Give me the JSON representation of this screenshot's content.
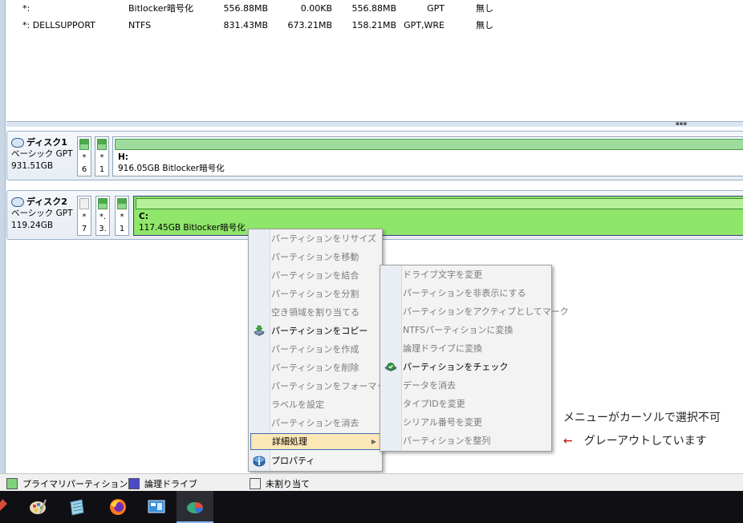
{
  "table": {
    "rows": [
      {
        "name": "*:",
        "fs": "Bitlocker暗号化",
        "capacity": "556.88MB",
        "used": "0.00KB",
        "free": "556.88MB",
        "flags": "GPT",
        "status": "無し"
      },
      {
        "name": "*: DELLSUPPORT",
        "fs": "NTFS",
        "capacity": "831.43MB",
        "used": "673.21MB",
        "free": "158.21MB",
        "flags": "GPT,WRE",
        "status": "無し"
      }
    ]
  },
  "disks": [
    {
      "title": "ディスク1",
      "type": "ベーシック GPT",
      "size": "931.51GB",
      "small_parts": [
        {
          "top": "*",
          "bottom": "6"
        },
        {
          "top": "*",
          "bottom": "1"
        }
      ],
      "main_part": {
        "letter": "H:",
        "desc": "916.05GB Bitlocker暗号化"
      }
    },
    {
      "title": "ディスク2",
      "type": "ベーシック GPT",
      "size": "119.24GB",
      "small_parts": [
        {
          "top": "*",
          "bottom": "7"
        },
        {
          "top": "*.",
          "bottom": "3."
        },
        {
          "top": "*",
          "bottom": "1"
        }
      ],
      "main_part": {
        "letter": "C:",
        "desc": "117.45GB Bitlocker暗号化"
      }
    }
  ],
  "context_menu": {
    "items": [
      {
        "label": "パーティションをリサイズ",
        "enabled": false
      },
      {
        "label": "パーティションを移動",
        "enabled": false
      },
      {
        "label": "パーティションを結合",
        "enabled": false
      },
      {
        "label": "パーティションを分割",
        "enabled": false
      },
      {
        "label": "空き領域を割り当てる",
        "enabled": false
      },
      {
        "label": "パーティションをコピー",
        "enabled": true,
        "icon": "copy-partition-icon"
      },
      {
        "label": "パーティションを作成",
        "enabled": false
      },
      {
        "label": "パーティションを削除",
        "enabled": false
      },
      {
        "label": "パーティションをフォーマット",
        "enabled": false
      },
      {
        "label": "ラベルを設定",
        "enabled": false
      },
      {
        "label": "パーティションを消去",
        "enabled": false
      },
      {
        "label": "詳細処理",
        "enabled": true,
        "highlighted": true,
        "submenu": true
      },
      {
        "label": "プロパティ",
        "enabled": true,
        "icon": "info-icon"
      }
    ]
  },
  "submenu": {
    "items": [
      {
        "label": "ドライブ文字を変更",
        "enabled": false
      },
      {
        "label": "パーティションを非表示にする",
        "enabled": false
      },
      {
        "label": "パーティションをアクティブとしてマーク",
        "enabled": false
      },
      {
        "label": "NTFSパーティションに変換",
        "enabled": false
      },
      {
        "label": "論理ドライブに変換",
        "enabled": false
      },
      {
        "label": "パーティションをチェック",
        "enabled": true,
        "icon": "check-shield-icon"
      },
      {
        "label": "データを消去",
        "enabled": false
      },
      {
        "label": "タイプIDを変更",
        "enabled": false
      },
      {
        "label": "シリアル番号を変更",
        "enabled": false
      },
      {
        "label": "パーティションを整列",
        "enabled": false
      }
    ]
  },
  "annotation": {
    "line1": "メニューがカーソルで選択不可",
    "arrow": "←",
    "line2": "グレーアウトしています"
  },
  "legend": {
    "primary": "プライマリパーティション",
    "logical": "論理ドライブ",
    "unallocated": "未割り当て",
    "colors": {
      "primary": "#7fd37f",
      "logical": "#4a4ac8",
      "unallocated": "#f0f0f0"
    }
  },
  "taskbar": {
    "icons": [
      "paint-icon",
      "notepad-icon",
      "firefox-icon",
      "control-panel-icon",
      "partition-tool-icon"
    ]
  }
}
